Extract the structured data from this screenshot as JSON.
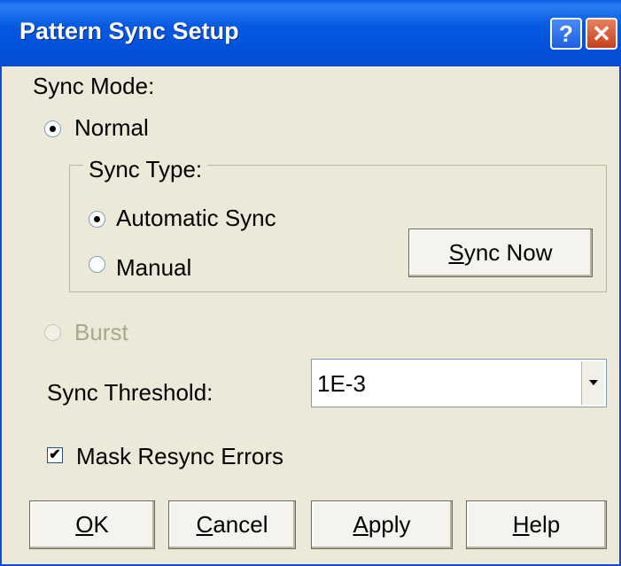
{
  "window": {
    "title": "Pattern Sync Setup",
    "help_button": "?",
    "close_button": "✕"
  },
  "sync_mode": {
    "label": "Sync Mode:",
    "normal_label": "Normal",
    "normal_selected": true,
    "burst_label": "Burst",
    "burst_enabled": false
  },
  "sync_type": {
    "legend": "Sync Type:",
    "automatic_label": "Automatic Sync",
    "automatic_selected": true,
    "manual_label": "Manual",
    "sync_now": {
      "accel": "S",
      "rest": "ync Now"
    }
  },
  "threshold": {
    "label": "Sync Threshold:",
    "selected_value": "1E-3"
  },
  "mask": {
    "label": "Mask Resync Errors",
    "checked": true,
    "mark": "✔"
  },
  "buttons": {
    "ok": {
      "accel": "O",
      "rest": "K"
    },
    "cancel": {
      "accel": "C",
      "rest": "ancel"
    },
    "apply": {
      "accel": "A",
      "rest": "pply"
    },
    "help": {
      "accel": "H",
      "rest": "elp"
    }
  },
  "colors": {
    "titlebar": "#0458e1",
    "dialog_bg": "#ece9d8",
    "disabled_text": "#a9a792"
  }
}
